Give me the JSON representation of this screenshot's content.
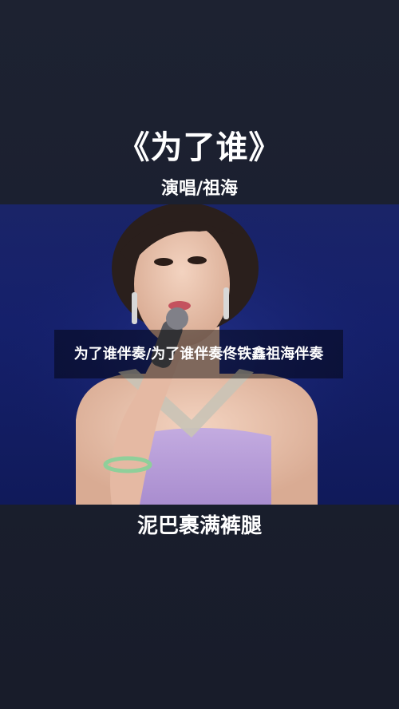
{
  "video": {
    "title": "《为了谁》",
    "performer": "演唱/祖海",
    "lyric_line": "泥巴裹满裤腿"
  },
  "overlay": {
    "caption": "为了谁伴奏/为了谁伴奏佟铁鑫祖海伴奏"
  },
  "colors": {
    "background": "#1a1f2e",
    "stage": "#15206b",
    "dress": "#b49ad6",
    "text": "#ffffff"
  }
}
